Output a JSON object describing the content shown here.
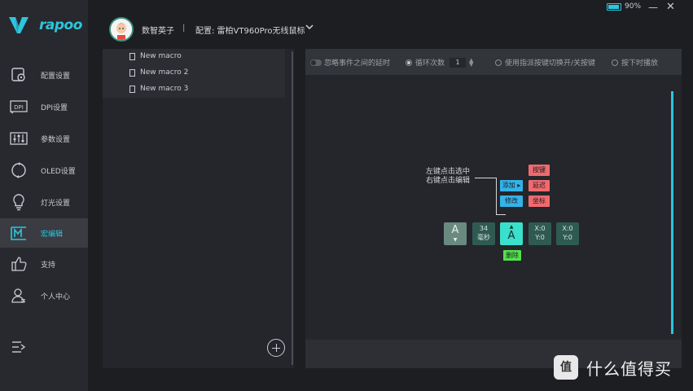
{
  "app": {
    "logo_text": "rapoo"
  },
  "sidebar": {
    "items": [
      {
        "label": "配置设置",
        "icon": "config-icon"
      },
      {
        "label": "DPI设置",
        "icon": "dpi-icon"
      },
      {
        "label": "参数设置",
        "icon": "params-icon"
      },
      {
        "label": "OLED设置",
        "icon": "oled-icon"
      },
      {
        "label": "灯光设置",
        "icon": "light-icon"
      },
      {
        "label": "宏编辑",
        "icon": "macro-icon",
        "active": true
      },
      {
        "label": "支持",
        "icon": "thumbs-up-icon"
      },
      {
        "label": "个人中心",
        "icon": "user-icon"
      }
    ],
    "dpi_icon_text": "DPI"
  },
  "header": {
    "user_name": "数智英子",
    "separator": "|",
    "config_label": "配置: 雷柏VT960Pro无线鼠标",
    "battery": "90%",
    "battery_level": 0.9,
    "minimize": "—",
    "close": "✕"
  },
  "macros": {
    "items": [
      "New macro",
      "New macro 2",
      "New macro 3"
    ]
  },
  "options": {
    "ignore_delay": "忽略事件之间的延时",
    "loop_count_label": "循环次数",
    "loop_count_value": "1",
    "toggle_by_key": "使用指派按键切换开/关按键",
    "while_pressed": "按下时播放"
  },
  "editor": {
    "hint_line1": "左键点击选中",
    "hint_line2": "右键点击编辑",
    "add_label": "添加",
    "modify_label": "修改",
    "key_label": "按键",
    "delay_label": "延迟",
    "coord_label": "坐标",
    "delete_label": "删除",
    "key1": "A",
    "delay_value": "34",
    "delay_unit": "毫秒",
    "key2": "A",
    "coord1_x": "X:0",
    "coord1_y": "Y:0",
    "coord2_x": "X:0",
    "coord2_y": "Y:0",
    "arrow_down": "▼",
    "arrow_up": "▲"
  },
  "watermark": {
    "badge": "值",
    "text": "什么值得买"
  },
  "colors": {
    "accent": "#2cc6de",
    "background": "#1c1e22",
    "panel": "#24262b"
  }
}
